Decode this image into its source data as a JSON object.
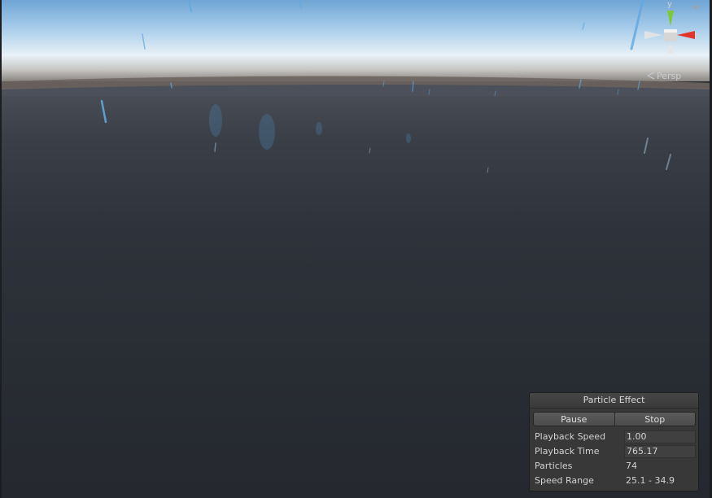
{
  "scene_view": {
    "projection_label": "Persp",
    "gizmo_axes": {
      "y": "y",
      "x": "x"
    },
    "colors": {
      "sky_top": "#6fa4d4",
      "horizon": "#e8f1f6",
      "ground": "#282c33",
      "axis_y": "#7ec832",
      "axis_x": "#e0352a"
    }
  },
  "particle_panel": {
    "title": "Particle Effect",
    "pause_label": "Pause",
    "stop_label": "Stop",
    "rows": [
      {
        "label": "Playback Speed",
        "value": "1.00"
      },
      {
        "label": "Playback Time",
        "value": "765.17"
      },
      {
        "label": "Particles",
        "value": "74"
      },
      {
        "label": "Speed Range",
        "value": "25.1 - 34.9"
      }
    ]
  }
}
